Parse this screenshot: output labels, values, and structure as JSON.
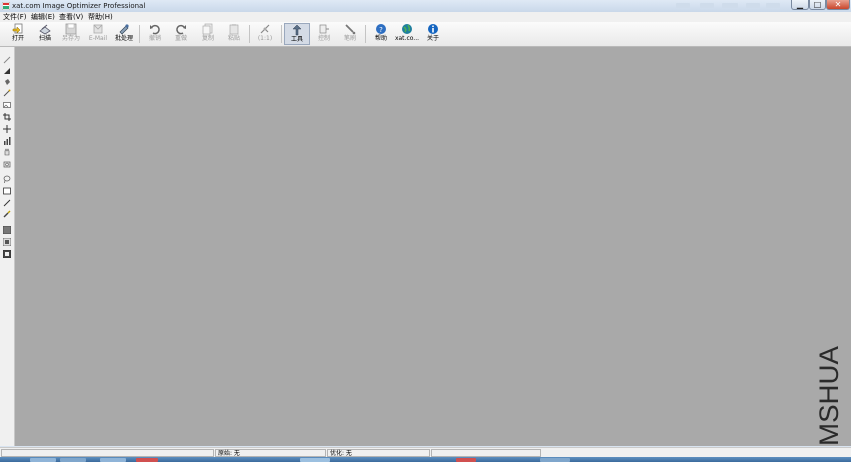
{
  "window": {
    "title": "xat.com Image Optimizer Professional"
  },
  "window_controls": {
    "minimize": "▁",
    "maximize": "□",
    "close": "✕"
  },
  "menu": [
    "文件(F)",
    "编辑(E)",
    "查看(V)",
    "帮助(H)"
  ],
  "toolbar": [
    {
      "label": "打开",
      "icon": "open-icon",
      "enabled": true
    },
    {
      "label": "扫描",
      "icon": "scan-icon",
      "enabled": true
    },
    {
      "label": "另存为",
      "icon": "save-as-icon",
      "enabled": false
    },
    {
      "label": "E-Mail",
      "icon": "email-icon",
      "enabled": false
    },
    {
      "label": "批处理",
      "icon": "batch-icon",
      "enabled": true
    },
    {
      "label": "撤销",
      "icon": "undo-icon",
      "enabled": false
    },
    {
      "label": "重做",
      "icon": "redo-icon",
      "enabled": false
    },
    {
      "label": "复制",
      "icon": "copy-icon",
      "enabled": false
    },
    {
      "label": "粘贴",
      "icon": "paste-icon",
      "enabled": false
    },
    {
      "label": "(1:1)",
      "icon": "zoom-actual-icon",
      "enabled": false
    },
    {
      "label": "工具",
      "icon": "tools-icon",
      "enabled": true,
      "pressed": true
    },
    {
      "label": "控制",
      "icon": "control-icon",
      "enabled": false
    },
    {
      "label": "笔刷",
      "icon": "brush-icon",
      "enabled": false
    },
    {
      "label": "帮助",
      "icon": "help-icon",
      "enabled": true
    },
    {
      "label": "xat.co...",
      "icon": "globe-icon",
      "enabled": true
    },
    {
      "label": "关于",
      "icon": "info-icon",
      "enabled": true
    }
  ],
  "left_tools": [
    "pen-tool-icon",
    "triangle-tool-icon",
    "fill-tool-icon",
    "wand-tool-icon",
    "image-tool-icon",
    "crop-tool-icon",
    "move-tool-icon",
    "chart-tool-icon",
    "hand-tool-icon",
    "rotate-tool-icon",
    "lasso-tool-icon",
    "rectangle-tool-icon",
    "line-tool-icon",
    "brush-tool-icon",
    "swatch-gray-icon",
    "swatch-square-icon",
    "swatch-dark-icon"
  ],
  "status": {
    "cell1": "",
    "original": "原始: 无",
    "optimized": "优化: 无",
    "cell4": ""
  },
  "watermark": "MSHUA",
  "colors": {
    "canvas": "#a9a9a9",
    "toolbar": "#f0f0f0",
    "accent": "#2e6fc2"
  }
}
